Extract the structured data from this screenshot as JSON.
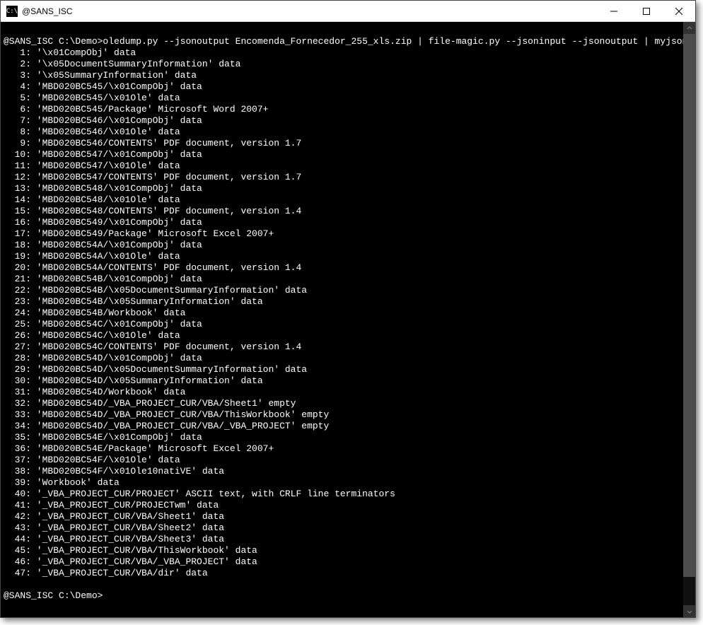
{
  "window": {
    "title": "@SANS_ISC"
  },
  "prompt": {
    "prefix": "@SANS_ISC C:\\Demo>",
    "command": "oledump.py --jsonoutput Encomenda_Fornecedor_255_xls.zip | file-magic.py --jsoninput --jsonoutput | myjson-filter.py -l"
  },
  "rows": [
    {
      "idx": "1",
      "text": "'\\x01CompObj' data"
    },
    {
      "idx": "2",
      "text": "'\\x05DocumentSummaryInformation' data"
    },
    {
      "idx": "3",
      "text": "'\\x05SummaryInformation' data"
    },
    {
      "idx": "4",
      "text": "'MBD020BC545/\\x01CompObj' data"
    },
    {
      "idx": "5",
      "text": "'MBD020BC545/\\x01Ole' data"
    },
    {
      "idx": "6",
      "text": "'MBD020BC545/Package' Microsoft Word 2007+"
    },
    {
      "idx": "7",
      "text": "'MBD020BC546/\\x01CompObj' data"
    },
    {
      "idx": "8",
      "text": "'MBD020BC546/\\x01Ole' data"
    },
    {
      "idx": "9",
      "text": "'MBD020BC546/CONTENTS' PDF document, version 1.7"
    },
    {
      "idx": "10",
      "text": "'MBD020BC547/\\x01CompObj' data"
    },
    {
      "idx": "11",
      "text": "'MBD020BC547/\\x01Ole' data"
    },
    {
      "idx": "12",
      "text": "'MBD020BC547/CONTENTS' PDF document, version 1.7"
    },
    {
      "idx": "13",
      "text": "'MBD020BC548/\\x01CompObj' data"
    },
    {
      "idx": "14",
      "text": "'MBD020BC548/\\x01Ole' data"
    },
    {
      "idx": "15",
      "text": "'MBD020BC548/CONTENTS' PDF document, version 1.4"
    },
    {
      "idx": "16",
      "text": "'MBD020BC549/\\x01CompObj' data"
    },
    {
      "idx": "17",
      "text": "'MBD020BC549/Package' Microsoft Excel 2007+"
    },
    {
      "idx": "18",
      "text": "'MBD020BC54A/\\x01CompObj' data"
    },
    {
      "idx": "19",
      "text": "'MBD020BC54A/\\x01Ole' data"
    },
    {
      "idx": "20",
      "text": "'MBD020BC54A/CONTENTS' PDF document, version 1.4"
    },
    {
      "idx": "21",
      "text": "'MBD020BC54B/\\x01CompObj' data"
    },
    {
      "idx": "22",
      "text": "'MBD020BC54B/\\x05DocumentSummaryInformation' data"
    },
    {
      "idx": "23",
      "text": "'MBD020BC54B/\\x05SummaryInformation' data"
    },
    {
      "idx": "24",
      "text": "'MBD020BC54B/Workbook' data"
    },
    {
      "idx": "25",
      "text": "'MBD020BC54C/\\x01CompObj' data"
    },
    {
      "idx": "26",
      "text": "'MBD020BC54C/\\x01Ole' data"
    },
    {
      "idx": "27",
      "text": "'MBD020BC54C/CONTENTS' PDF document, version 1.4"
    },
    {
      "idx": "28",
      "text": "'MBD020BC54D/\\x01CompObj' data"
    },
    {
      "idx": "29",
      "text": "'MBD020BC54D/\\x05DocumentSummaryInformation' data"
    },
    {
      "idx": "30",
      "text": "'MBD020BC54D/\\x05SummaryInformation' data"
    },
    {
      "idx": "31",
      "text": "'MBD020BC54D/Workbook' data"
    },
    {
      "idx": "32",
      "text": "'MBD020BC54D/_VBA_PROJECT_CUR/VBA/Sheet1' empty"
    },
    {
      "idx": "33",
      "text": "'MBD020BC54D/_VBA_PROJECT_CUR/VBA/ThisWorkbook' empty"
    },
    {
      "idx": "34",
      "text": "'MBD020BC54D/_VBA_PROJECT_CUR/VBA/_VBA_PROJECT' empty"
    },
    {
      "idx": "35",
      "text": "'MBD020BC54E/\\x01CompObj' data"
    },
    {
      "idx": "36",
      "text": "'MBD020BC54E/Package' Microsoft Excel 2007+"
    },
    {
      "idx": "37",
      "text": "'MBD020BC54F/\\x01Ole' data"
    },
    {
      "idx": "38",
      "text": "'MBD020BC54F/\\x01Ole10natiVE' data"
    },
    {
      "idx": "39",
      "text": "'Workbook' data"
    },
    {
      "idx": "40",
      "text": "'_VBA_PROJECT_CUR/PROJECT' ASCII text, with CRLF line terminators"
    },
    {
      "idx": "41",
      "text": "'_VBA_PROJECT_CUR/PROJECTwm' data"
    },
    {
      "idx": "42",
      "text": "'_VBA_PROJECT_CUR/VBA/Sheet1' data"
    },
    {
      "idx": "43",
      "text": "'_VBA_PROJECT_CUR/VBA/Sheet2' data"
    },
    {
      "idx": "44",
      "text": "'_VBA_PROJECT_CUR/VBA/Sheet3' data"
    },
    {
      "idx": "45",
      "text": "'_VBA_PROJECT_CUR/VBA/ThisWorkbook' data"
    },
    {
      "idx": "46",
      "text": "'_VBA_PROJECT_CUR/VBA/_VBA_PROJECT' data"
    },
    {
      "idx": "47",
      "text": "'_VBA_PROJECT_CUR/VBA/dir' data"
    }
  ],
  "prompt2": "@SANS_ISC C:\\Demo>"
}
